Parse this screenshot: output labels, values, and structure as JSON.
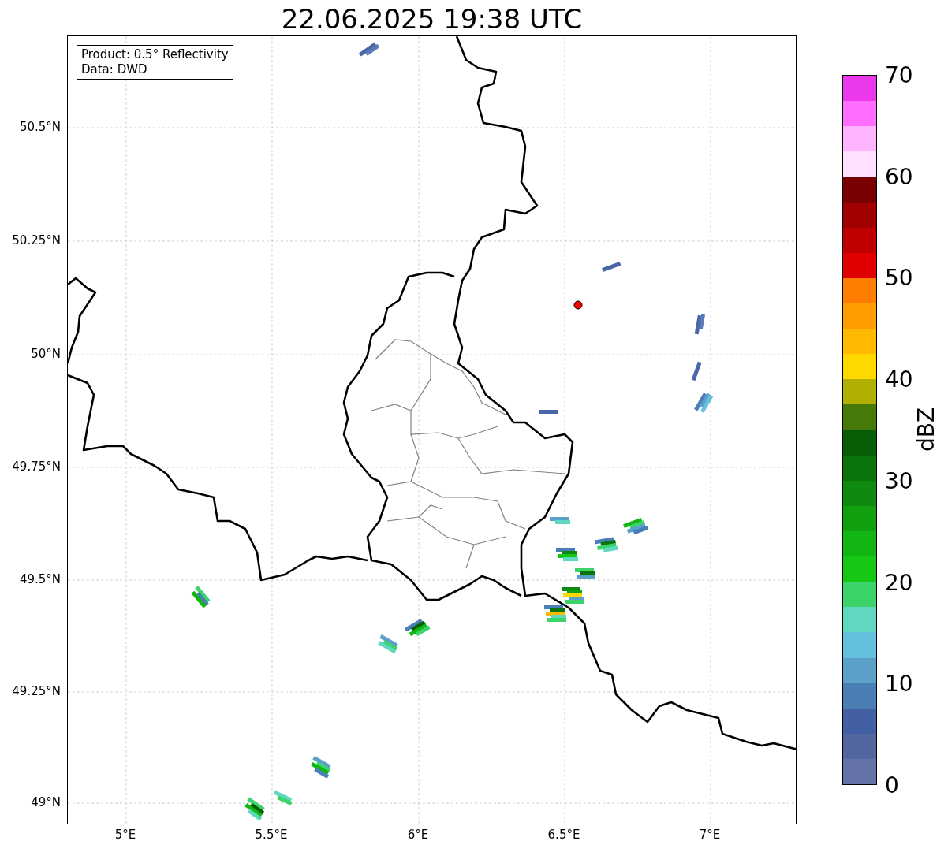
{
  "title": "22.06.2025 19:38 UTC",
  "info_box": {
    "lines": [
      "Product: 0.5° Reflectivity",
      "Data: DWD"
    ]
  },
  "map": {
    "y_ticks": [
      "50.5°N",
      "50.25°N",
      "50°N",
      "49.75°N",
      "49.5°N",
      "49.25°N",
      "49°N"
    ],
    "x_ticks": [
      "5°E",
      "5.5°E",
      "6°E",
      "6.5°E",
      "7°E"
    ]
  },
  "colorbar": {
    "label": "dBZ",
    "ticks": [
      "70",
      "60",
      "50",
      "40",
      "30",
      "20",
      "10",
      "0"
    ]
  }
}
